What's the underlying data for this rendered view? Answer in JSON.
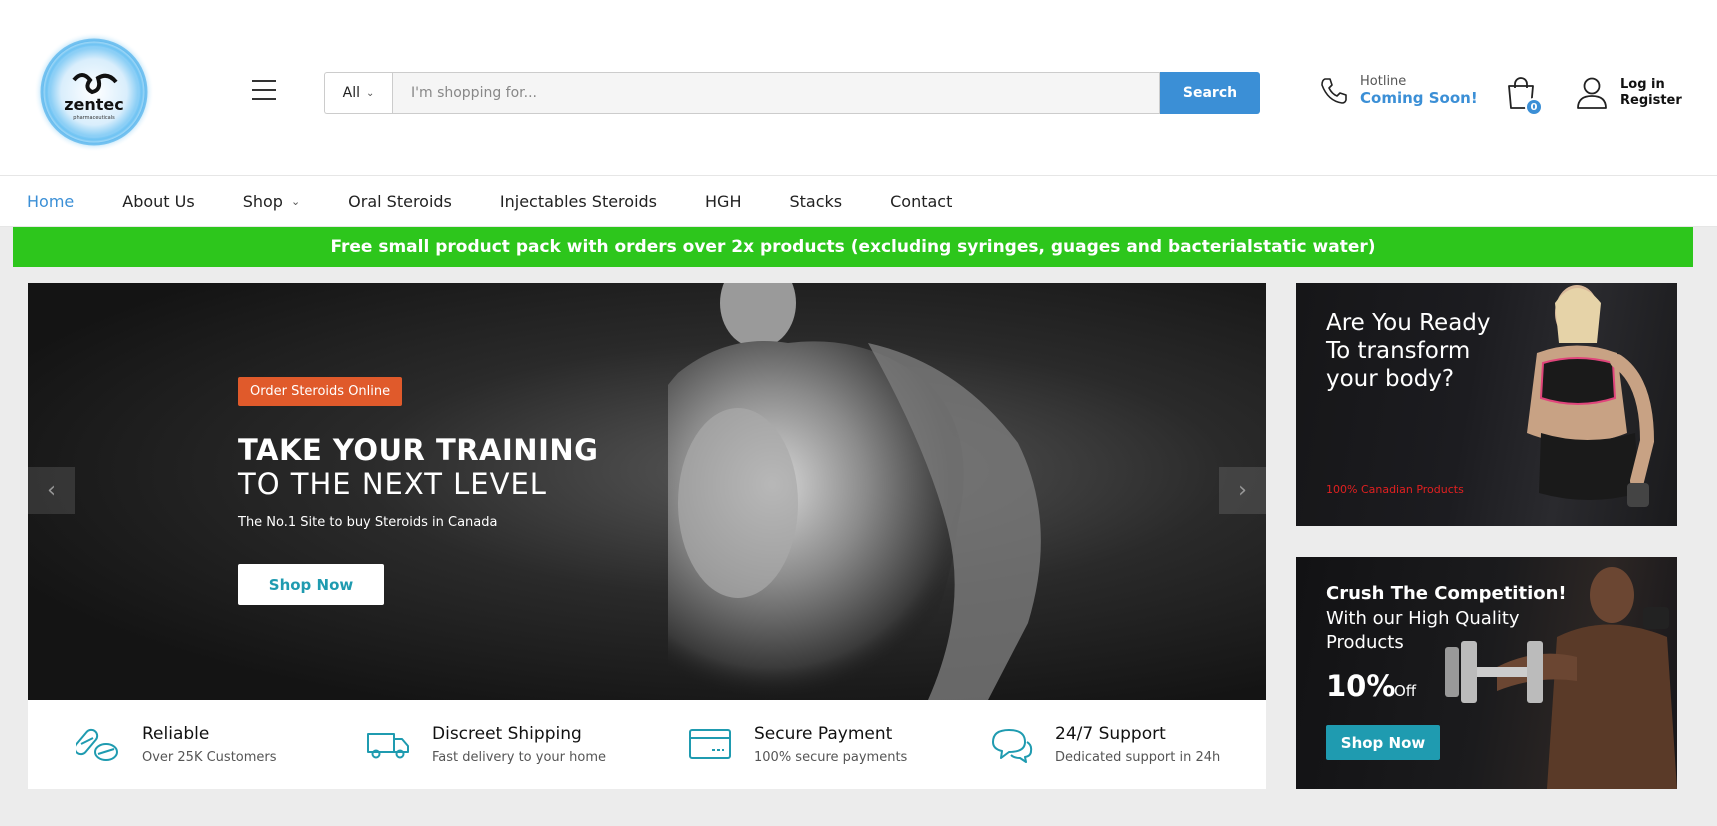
{
  "header": {
    "logo_text": "zentec",
    "logo_subtext": "pharmaceuticals",
    "search": {
      "category": "All",
      "placeholder": "I'm shopping for...",
      "button_label": "Search"
    },
    "hotline": {
      "label": "Hotline",
      "value": "Coming Soon!"
    },
    "cart_count": "0",
    "account": {
      "login_label": "Log in",
      "register_label": "Register"
    }
  },
  "nav": {
    "items": [
      {
        "label": "Home"
      },
      {
        "label": "About Us"
      },
      {
        "label": "Shop"
      },
      {
        "label": "Oral Steroids"
      },
      {
        "label": "Injectables Steroids"
      },
      {
        "label": "HGH"
      },
      {
        "label": "Stacks"
      },
      {
        "label": "Contact"
      }
    ]
  },
  "promo": {
    "text": "Free small product pack with orders over 2x products (excluding syringes, guages and bacterialstatic water)"
  },
  "slider": {
    "badge": "Order Steroids Online",
    "title_line1": "TAKE YOUR TRAINING",
    "title_line2": "TO THE NEXT LEVEL",
    "subtitle": "The No.1 Site to buy Steroids in Canada",
    "button_label": "Shop Now"
  },
  "features": [
    {
      "title": "Reliable",
      "desc": "Over 25K Customers",
      "icon": "pills-icon"
    },
    {
      "title": "Discreet Shipping",
      "desc": "Fast delivery to your home",
      "icon": "truck-icon"
    },
    {
      "title": "Secure Payment",
      "desc": "100% secure payments",
      "icon": "credit-card-icon"
    },
    {
      "title": "24/7 Support",
      "desc": "Dedicated support in 24h",
      "icon": "chat-icon"
    }
  ],
  "banner1": {
    "title": "Are You Ready To transform your body?",
    "small": "100% Canadian Products"
  },
  "banner2": {
    "title": "Crush The Competition!",
    "subtitle": "With our High Quality Products",
    "percent": "10%",
    "off": "Off",
    "button_label": "Shop Now"
  },
  "colors": {
    "accent_blue": "#3b8fd6",
    "promo_green": "#2dc61c",
    "badge_orange": "#e05a2b",
    "teal": "#1f9bb0"
  }
}
